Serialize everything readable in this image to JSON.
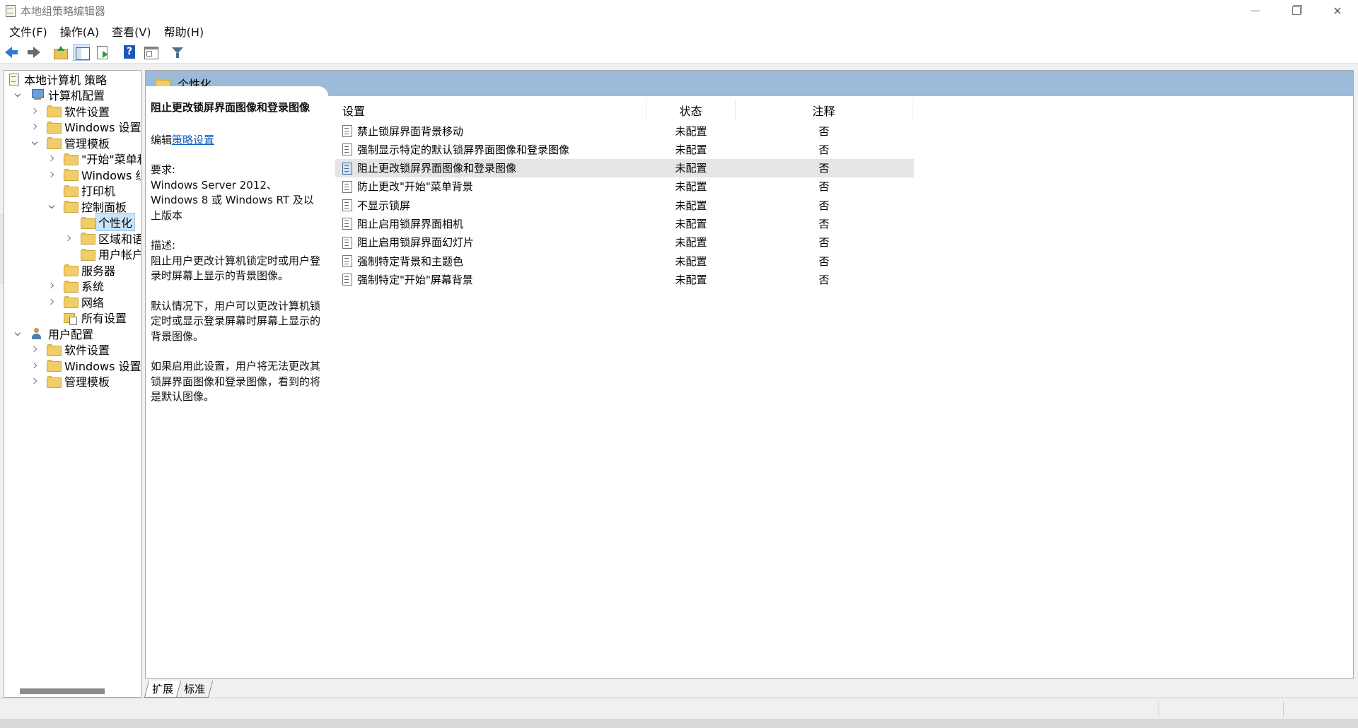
{
  "window": {
    "title": "本地组策略编辑器",
    "close_symbol": "✕"
  },
  "menu": [
    "文件(F)",
    "操作(A)",
    "查看(V)",
    "帮助(H)"
  ],
  "tree": {
    "root": "本地计算机 策略",
    "items": [
      {
        "label": "计算机配置",
        "level": 1,
        "expander": "down",
        "icon": "computer-icon"
      },
      {
        "label": "软件设置",
        "level": 2,
        "expander": "right",
        "icon": "folder-icon"
      },
      {
        "label": "Windows 设置",
        "level": 2,
        "expander": "right",
        "icon": "folder-icon"
      },
      {
        "label": "管理模板",
        "level": 2,
        "expander": "down",
        "icon": "folder-icon"
      },
      {
        "label": "\"开始\"菜单和",
        "level": 3,
        "expander": "right",
        "icon": "folder-icon"
      },
      {
        "label": "Windows 组件",
        "level": 3,
        "expander": "right",
        "icon": "folder-icon"
      },
      {
        "label": "打印机",
        "level": 3,
        "expander": "none",
        "icon": "folder-icon"
      },
      {
        "label": "控制面板",
        "level": 3,
        "expander": "down",
        "icon": "folder-icon"
      },
      {
        "label": "个性化",
        "level": 4,
        "expander": "none",
        "icon": "folder-icon",
        "selected": true
      },
      {
        "label": "区域和语言",
        "level": 4,
        "expander": "right",
        "icon": "folder-icon"
      },
      {
        "label": "用户帐户",
        "level": 4,
        "expander": "none",
        "icon": "folder-icon"
      },
      {
        "label": "服务器",
        "level": 3,
        "expander": "none",
        "icon": "folder-icon"
      },
      {
        "label": "系统",
        "level": 3,
        "expander": "right",
        "icon": "folder-icon"
      },
      {
        "label": "网络",
        "level": 3,
        "expander": "right",
        "icon": "folder-icon"
      },
      {
        "label": "所有设置",
        "level": 3,
        "expander": "none",
        "icon": "settings-icon"
      },
      {
        "label": "用户配置",
        "level": 1,
        "expander": "down",
        "icon": "user-icon"
      },
      {
        "label": "软件设置",
        "level": 2,
        "expander": "right",
        "icon": "folder-icon"
      },
      {
        "label": "Windows 设置",
        "level": 2,
        "expander": "right",
        "icon": "folder-icon"
      },
      {
        "label": "管理模板",
        "level": 2,
        "expander": "right",
        "icon": "folder-icon"
      }
    ]
  },
  "main": {
    "header_title": "个性化",
    "description": {
      "title": "阻止更改锁屏界面图像和登录图像",
      "edit_prefix": "编辑",
      "edit_link": "策略设置",
      "requirements_label": "要求:",
      "requirements_text": "Windows Server 2012、Windows 8 或 Windows RT 及以上版本",
      "description_label": "描述:",
      "description_text": "阻止用户更改计算机锁定时或用户登录时屏幕上显示的背景图像。",
      "paragraph_2": "默认情况下，用户可以更改计算机锁定时或显示登录屏幕时屏幕上显示的背景图像。",
      "paragraph_3": "如果启用此设置，用户将无法更改其锁屏界面图像和登录图像，看到的将是默认图像。"
    },
    "columns": {
      "setting": "设置",
      "state": "状态",
      "comment": "注释"
    },
    "rows": [
      {
        "setting": "禁止锁屏界面背景移动",
        "state": "未配置",
        "comment": "否"
      },
      {
        "setting": "强制显示特定的默认锁屏界面图像和登录图像",
        "state": "未配置",
        "comment": "否"
      },
      {
        "setting": "阻止更改锁屏界面图像和登录图像",
        "state": "未配置",
        "comment": "否",
        "highlight": true
      },
      {
        "setting": "防止更改\"开始\"菜单背景",
        "state": "未配置",
        "comment": "否"
      },
      {
        "setting": "不显示锁屏",
        "state": "未配置",
        "comment": "否"
      },
      {
        "setting": "阻止启用锁屏界面相机",
        "state": "未配置",
        "comment": "否"
      },
      {
        "setting": "阻止启用锁屏界面幻灯片",
        "state": "未配置",
        "comment": "否"
      },
      {
        "setting": "强制特定背景和主题色",
        "state": "未配置",
        "comment": "否"
      },
      {
        "setting": "强制特定\"开始\"屏幕背景",
        "state": "未配置",
        "comment": "否"
      }
    ]
  },
  "tabs": [
    {
      "label": "扩展",
      "active": true
    },
    {
      "label": "标准",
      "active": false
    }
  ],
  "colors": {
    "header_band": "#9cbbd9",
    "link": "#0f62c6",
    "selection": "#cce4f7"
  }
}
